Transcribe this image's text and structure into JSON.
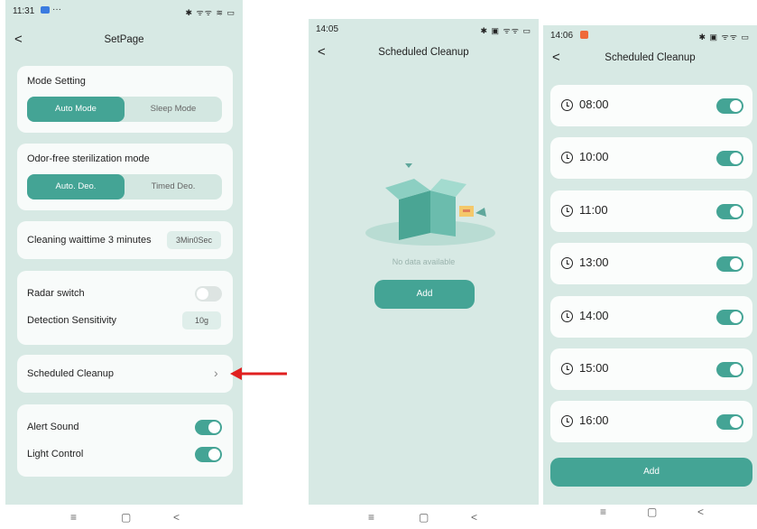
{
  "phone1": {
    "status": {
      "time": "11:31",
      "icons": "✱ ᯤᯤ ≋ ▭"
    },
    "nav": {
      "back": "<",
      "title": "SetPage"
    },
    "mode": {
      "label": "Mode Setting",
      "options": [
        "Auto Mode",
        "Sleep Mode"
      ],
      "selected": "Auto Mode"
    },
    "odor": {
      "label": "Odor-free sterilization mode",
      "options": [
        "Auto. Deo.",
        "Timed Deo."
      ],
      "selected": "Auto. Deo."
    },
    "cleaning": {
      "label": "Cleaning waittime 3 minutes",
      "value": "3Min0Sec"
    },
    "radar": {
      "label": "Radar switch",
      "on": false
    },
    "sensitivity": {
      "label": "Detection Sensitivity",
      "value": "10g"
    },
    "scheduled": {
      "label": "Scheduled Cleanup"
    },
    "alert": {
      "label": "Alert Sound",
      "on": true
    },
    "light": {
      "label": "Light Control",
      "on": true
    }
  },
  "phone2": {
    "status": {
      "time": "14:05",
      "icons": "✱ ▣ ᯤᯤ ▭"
    },
    "nav": {
      "back": "<",
      "title": "Scheduled Cleanup"
    },
    "empty_text": "No data available",
    "add_label": "Add"
  },
  "phone3": {
    "status": {
      "time": "14:06",
      "icons": "✱ ▣ ᯤᯤ ▭"
    },
    "nav": {
      "back": "<",
      "title": "Scheduled Cleanup"
    },
    "schedules": [
      {
        "time": "08:00",
        "on": true
      },
      {
        "time": "10:00",
        "on": true
      },
      {
        "time": "11:00",
        "on": true
      },
      {
        "time": "13:00",
        "on": true
      },
      {
        "time": "14:00",
        "on": true
      },
      {
        "time": "15:00",
        "on": true
      },
      {
        "time": "16:00",
        "on": true
      }
    ],
    "add_label": "Add"
  },
  "system_nav": {
    "menu": "≡",
    "home": "▢",
    "back": "<"
  },
  "colors": {
    "accent": "#44a495",
    "background": "#d7e9e4",
    "card": "#f8fbfa",
    "arrow": "#e02020"
  }
}
